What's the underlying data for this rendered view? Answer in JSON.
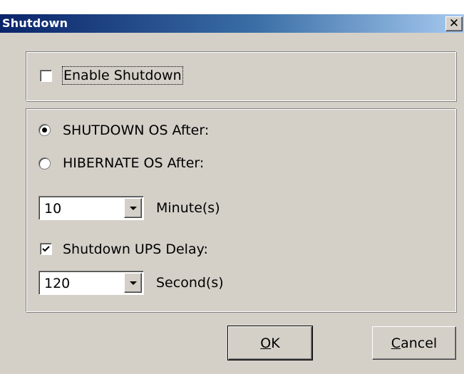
{
  "window": {
    "title": "Shutdown",
    "close_glyph": "✕"
  },
  "shutdown_group": {
    "enable_label": "Enable Shutdown",
    "enable_checked": false
  },
  "options_group": {
    "shutdown_os_label": "SHUTDOWN OS After:",
    "shutdown_os_selected": true,
    "hibernate_os_label": "HIBERNATE OS After:",
    "hibernate_os_selected": false,
    "minutes_value": "10",
    "minutes_unit": "Minute(s)",
    "ups_delay_label": "Shutdown UPS Delay:",
    "ups_delay_checked": true,
    "seconds_value": "120",
    "seconds_unit": "Second(s)"
  },
  "buttons": {
    "ok_mnemonic": "O",
    "ok_rest": "K",
    "cancel_mnemonic": "C",
    "cancel_rest": "ancel"
  },
  "icons": {
    "checkmark": "check-icon",
    "dropdown": "chevron-down-icon",
    "close": "close-icon"
  }
}
